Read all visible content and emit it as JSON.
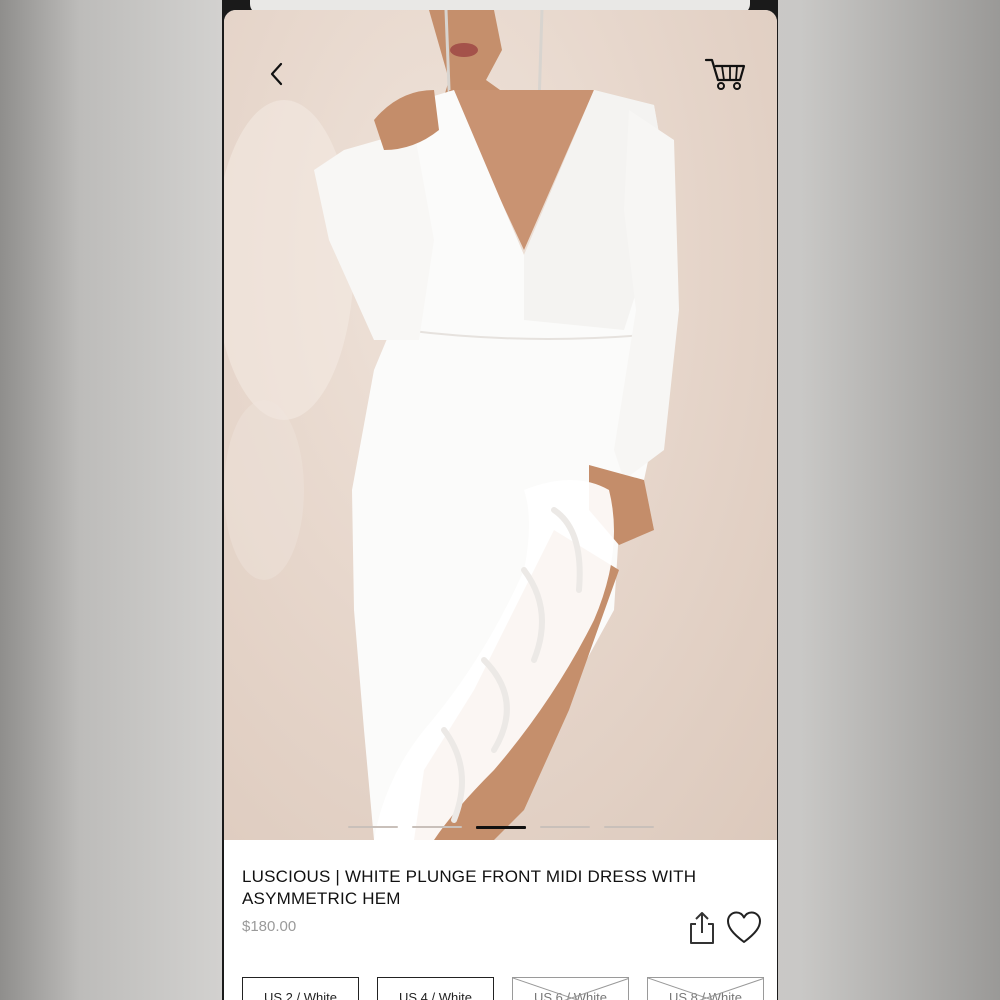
{
  "nav": {
    "back_icon": "chevron-left-icon",
    "cart_icon": "shopping-cart-icon"
  },
  "carousel": {
    "total": 5,
    "active_index": 2
  },
  "product": {
    "title": "LUSCIOUS | WHITE PLUNGE FRONT MIDI DRESS WITH ASYMMETRIC HEM",
    "price": "$180.00"
  },
  "actions": {
    "share_icon": "share-icon",
    "wishlist_icon": "heart-icon"
  },
  "sizes": [
    {
      "label": "US 2 / White",
      "available": true
    },
    {
      "label": "US 4 / White",
      "available": true
    },
    {
      "label": "US 6 / White",
      "available": false
    },
    {
      "label": "US 8 / White",
      "available": false
    }
  ],
  "colors": {
    "accent": "#111111",
    "price": "#9a9a9a",
    "backdrop": "#e7d7cc",
    "dress": "#fbfbfa"
  }
}
